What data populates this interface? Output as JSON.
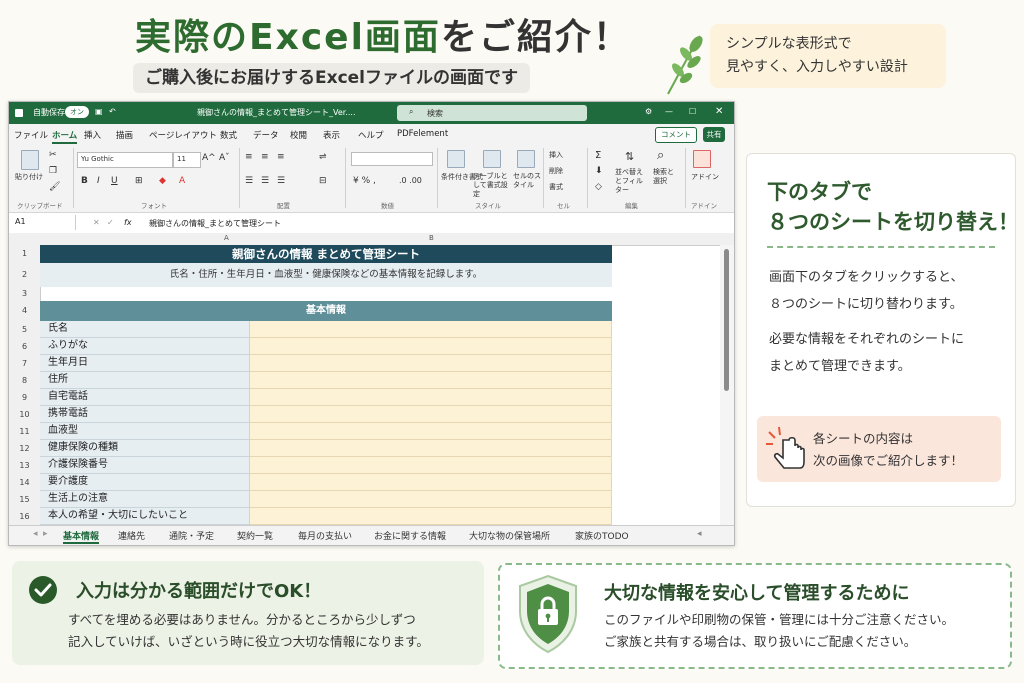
{
  "headline": {
    "part1": "実際のExcel画面",
    "part2": "をご紹介！"
  },
  "subheadline": "ご購入後にお届けするExcelファイルの画面です",
  "tip": {
    "line1": "シンプルな表形式で",
    "line2": "見やすく、入力しやすい設計"
  },
  "excel": {
    "titlebar": {
      "autosave": "自動保存",
      "toggle": "オン",
      "filename": "親御さんの情報_まとめて管理シート_Ver....",
      "search": "検索"
    },
    "menu": [
      "ファイル",
      "ホーム",
      "挿入",
      "描画",
      "ページレイアウト",
      "数式",
      "データ",
      "校閲",
      "表示",
      "ヘルプ",
      "PDFelement"
    ],
    "comment_button": "コメント",
    "share_button": "共有",
    "ribbon": {
      "paste": "貼り付け",
      "font_name": "Yu Gothic",
      "font_size": "11",
      "cond_format": "条件付き書式",
      "table_format": "テーブルとして書式設定",
      "cell_style": "セルのスタイル",
      "insert": "挿入",
      "delete": "削除",
      "format": "書式",
      "sort_filter": "並べ替えとフィルター",
      "find_select": "検索と選択",
      "addins": "アドイン",
      "groups": [
        "クリップボード",
        "フォント",
        "配置",
        "数値",
        "スタイル",
        "セル",
        "編集",
        "アドイン"
      ]
    },
    "namebox": "A1",
    "fx": "fx",
    "formula": "親御さんの情報_まとめて管理シート",
    "columns": [
      "A",
      "B"
    ],
    "sheet_title": "親御さんの情報 まとめて管理シート",
    "sheet_desc": "氏名・住所・生年月日・血液型・健康保険などの基本情報を記録します。",
    "section": "基本情報",
    "rows": [
      "氏名",
      "ふりがな",
      "生年月日",
      "住所",
      "自宅電話",
      "携帯電話",
      "血液型",
      "健康保険の種類",
      "介護保険番号",
      "要介護度",
      "生活上の注意",
      "本人の希望・大切にしたいこと"
    ],
    "row_numbers": [
      "1",
      "2",
      "3",
      "4",
      "5",
      "6",
      "7",
      "8",
      "9",
      "10",
      "11",
      "12",
      "13",
      "14",
      "15",
      "16"
    ],
    "tabs": [
      "基本情報",
      "連絡先",
      "通院・予定",
      "契約一覧",
      "毎月の支払い",
      "お金に関する情報",
      "大切な物の保管場所",
      "家族のTODO"
    ]
  },
  "right_card": {
    "title1": "下のタブで",
    "title2": "８つのシートを切り替え！",
    "p1": [
      "画面下のタブをクリックすると、",
      "８つのシートに切り替わります。"
    ],
    "p2": [
      "必要な情報をそれぞれのシートに",
      "まとめて管理できます。"
    ],
    "note": [
      "各シートの内容は",
      "次の画像でご紹介します！"
    ]
  },
  "box1": {
    "title": "入力は分かる範囲だけでOK！",
    "lines": [
      "すべてを埋める必要はありません。分かるところから少しずつ",
      "記入していけば、いざという時に役立つ大切な情報になります。"
    ]
  },
  "box2": {
    "title": "大切な情報を安心して管理するために",
    "lines": [
      "このファイルや印刷物の保管・管理には十分ご注意ください。",
      "ご家族と共有する場合は、取り扱いにご配慮ください。"
    ]
  },
  "colors": {
    "brand_green": "#2e6b2f",
    "excel_green": "#1f6b3e",
    "header_teal": "#1e4a5c",
    "section_teal": "#5f8f99",
    "input_fill": "#fdf1d6"
  }
}
